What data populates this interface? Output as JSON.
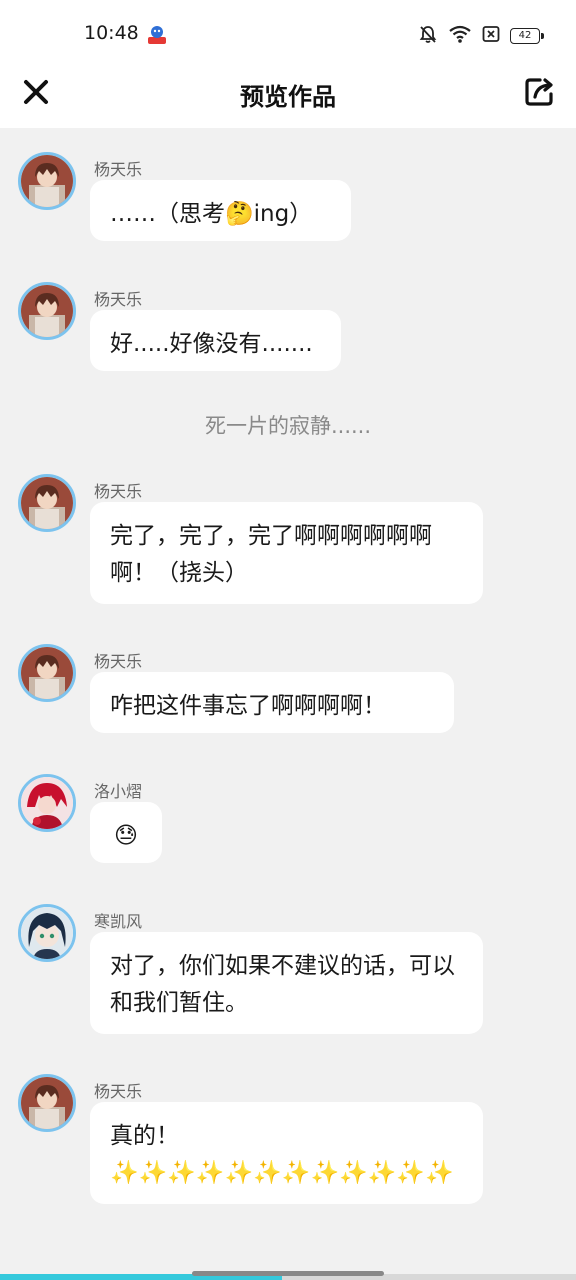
{
  "status_bar": {
    "time": "10:48",
    "battery": "42",
    "icons": [
      "app-notification-icon",
      "mute-bell-icon",
      "wifi-icon",
      "sim-off-icon",
      "battery-icon"
    ]
  },
  "header": {
    "title": "预览作品",
    "close_icon": "close-icon",
    "share_icon": "share-icon"
  },
  "messages": [
    {
      "type": "message",
      "sender": "杨天乐",
      "avatar": "avatar-yang-tianle",
      "text": "……（思考🤔ing）"
    },
    {
      "type": "message",
      "sender": "杨天乐",
      "avatar": "avatar-yang-tianle",
      "text": "好.....好像没有......."
    },
    {
      "type": "narration",
      "text": "死一片的寂静......"
    },
    {
      "type": "message",
      "sender": "杨天乐",
      "avatar": "avatar-yang-tianle",
      "text": "完了，完了，完了啊啊啊啊啊啊啊！（挠头）"
    },
    {
      "type": "message",
      "sender": "杨天乐",
      "avatar": "avatar-yang-tianle",
      "text": "咋把这件事忘了啊啊啊啊！"
    },
    {
      "type": "message",
      "sender": "洛小熠",
      "avatar": "avatar-luo-xiaoyi",
      "text": "😓"
    },
    {
      "type": "message",
      "sender": "寒凯风",
      "avatar": "avatar-han-kaifeng",
      "text": "对了，你们如果不建议的话，可以和我们暂住。"
    },
    {
      "type": "message",
      "sender": "杨天乐",
      "avatar": "avatar-yang-tianle",
      "text": "真的！✨✨✨✨✨✨✨✨✨✨✨✨"
    }
  ],
  "progress": {
    "fraction": 0.49
  },
  "colors": {
    "accent_progress": "#35c9dc",
    "avatar_border": "#7cc3ee",
    "bubble": "#ffffff",
    "background": "#f1f1f1"
  }
}
